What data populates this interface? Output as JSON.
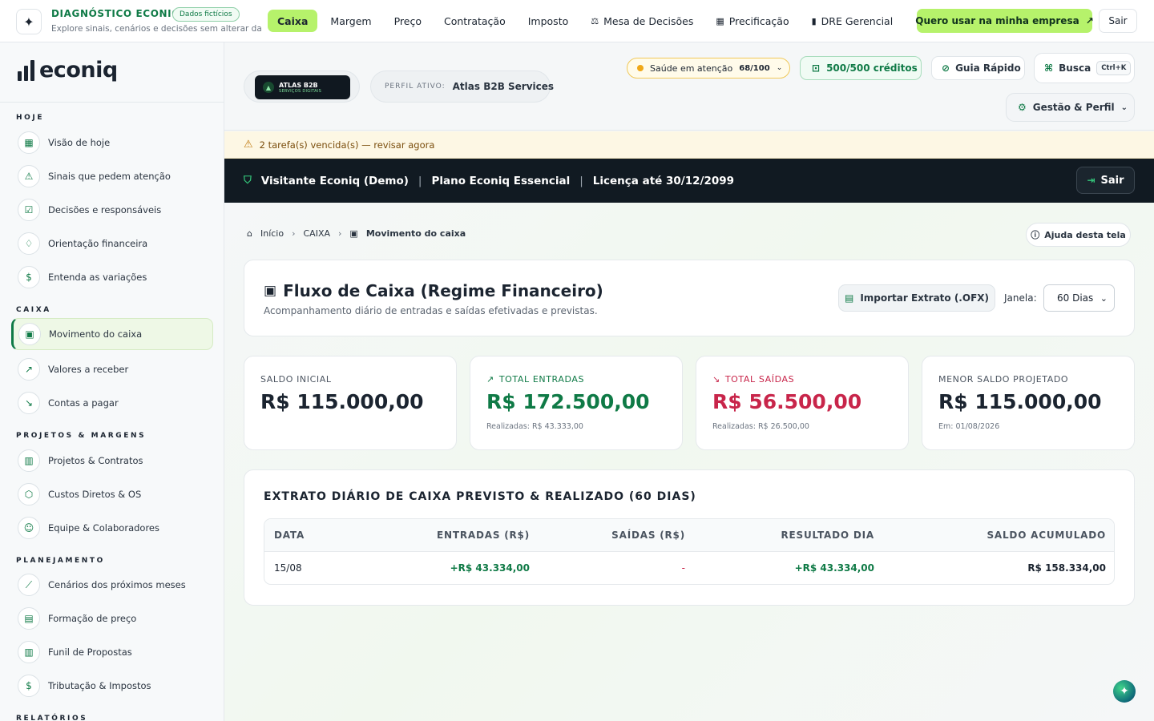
{
  "topbar": {
    "brand_title": "DIAGNÓSTICO ECONIQ",
    "brand_badge": "Dados fictícios",
    "brand_subtitle": "Explore sinais, cenários e decisões sem alterar da...",
    "tabs": [
      {
        "label": "Caixa",
        "icon": ""
      },
      {
        "label": "Margem",
        "icon": ""
      },
      {
        "label": "Preço",
        "icon": ""
      },
      {
        "label": "Contratação",
        "icon": ""
      },
      {
        "label": "Imposto",
        "icon": ""
      },
      {
        "label": "Mesa de Decisões",
        "icon": "gavel-icon"
      },
      {
        "label": "Precificação",
        "icon": "calculator-icon"
      },
      {
        "label": "DRE Gerencial",
        "icon": "document-icon"
      }
    ],
    "cta_label": "Quero usar na minha empresa",
    "logout_label": "Sair"
  },
  "sidebar": {
    "logo_text": "econiq",
    "sections": [
      {
        "title": "HOJE",
        "items": [
          {
            "label": "Visão de hoje",
            "icon": "grid-icon"
          },
          {
            "label": "Sinais que pedem atenção",
            "icon": "warning-icon"
          },
          {
            "label": "Decisões e responsáveis",
            "icon": "checkbox-icon"
          },
          {
            "label": "Orientação financeira",
            "icon": "lightbulb-icon"
          },
          {
            "label": "Entenda as variações",
            "icon": "file-dollar-icon"
          }
        ]
      },
      {
        "title": "CAIXA",
        "items": [
          {
            "label": "Movimento do caixa",
            "icon": "wallet-icon",
            "active": true
          },
          {
            "label": "Valores a receber",
            "icon": "trend-up-icon"
          },
          {
            "label": "Contas a pagar",
            "icon": "trend-down-icon"
          }
        ]
      },
      {
        "title": "PROJETOS & MARGENS",
        "items": [
          {
            "label": "Projetos & Contratos",
            "icon": "chart-box-icon"
          },
          {
            "label": "Custos Diretos & OS",
            "icon": "cube-icon"
          },
          {
            "label": "Equipe & Colaboradores",
            "icon": "user-plus-icon"
          }
        ]
      },
      {
        "title": "PLANEJAMENTO",
        "items": [
          {
            "label": "Cenários dos próximos meses",
            "icon": "line-chart-icon"
          },
          {
            "label": "Formação de preço",
            "icon": "calculator-icon"
          },
          {
            "label": "Funil de Propostas",
            "icon": "funnel-icon"
          },
          {
            "label": "Tributação & Impostos",
            "icon": "dollar-doc-icon"
          }
        ]
      },
      {
        "title": "RELATÓRIOS",
        "items": []
      }
    ]
  },
  "header": {
    "org_logo_line1": "ATLAS B2B",
    "org_logo_line2": "SERVIÇOS DIGITAIS",
    "profile_label": "PERFIL ATIVO:",
    "profile_value": "Atlas B2B Services",
    "health_label": "Saúde em atenção",
    "health_score": "68/100",
    "credits_label": "500/500 créditos",
    "guide_label": "Guia Rápido",
    "search_label": "Busca",
    "search_shortcut": "Ctrl+K",
    "management_label": "Gestão & Perfil"
  },
  "alert": {
    "text": "2 tarefa(s) vencida(s) — revisar agora"
  },
  "account_bar": {
    "user": "Visitante Econiq (Demo)",
    "plan": "Plano Econiq Essencial",
    "license": "Licença até 30/12/2099",
    "logout_label": "Sair"
  },
  "breadcrumb": {
    "home": "Início",
    "section": "CAIXA",
    "current": "Movimento do caixa"
  },
  "help_label": "Ajuda desta tela",
  "page": {
    "title": "Fluxo de Caixa (Regime Financeiro)",
    "subtitle": "Acompanhamento diário de entradas e saídas efetivadas e previstas.",
    "import_label": "Importar Extrato (.OFX)",
    "window_label": "Janela:",
    "window_value": "60 Dias"
  },
  "kpis": [
    {
      "label": "SALDO INICIAL",
      "value": "R$ 115.000,00",
      "sub": ""
    },
    {
      "label": "TOTAL ENTRADAS",
      "value": "R$ 172.500,00",
      "sub": "Realizadas: R$ 43.333,00"
    },
    {
      "label": "TOTAL SAÍDAS",
      "value": "R$ 56.500,00",
      "sub": "Realizadas: R$ 26.500,00"
    },
    {
      "label": "MENOR SALDO PROJETADO",
      "value": "R$ 115.000,00",
      "sub": "Em: 01/08/2026"
    }
  ],
  "statement": {
    "title": "EXTRATO DIÁRIO DE CAIXA PREVISTO & REALIZADO (60 DIAS)",
    "columns": [
      "DATA",
      "ENTRADAS (R$)",
      "SAÍDAS (R$)",
      "RESULTADO DIA",
      "SALDO ACUMULADO"
    ],
    "rows": [
      {
        "date": "15/08",
        "in": "+R$ 43.334,00",
        "out": "-",
        "result": "+R$ 43.334,00",
        "balance": "R$ 158.334,00"
      }
    ]
  },
  "colors": {
    "accent": "#b6f26b",
    "brand_green": "#0f7a46",
    "negative": "#c8254a",
    "dark_bar": "#111a22"
  }
}
